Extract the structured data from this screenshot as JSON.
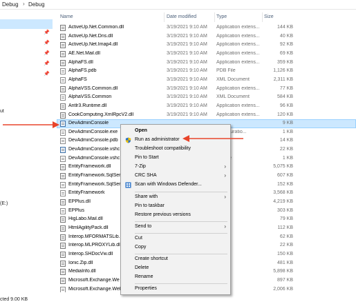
{
  "breadcrumb": {
    "part1": "Debug",
    "sep": "›",
    "part2": "Debug"
  },
  "nav": {
    "fragment_out": "ut",
    "fragment_drive": "(E:)"
  },
  "header": {
    "name": "Name",
    "date": "Date modified",
    "type": "Type",
    "size": "Size"
  },
  "files": [
    {
      "name": "ActiveUp.Net.Common.dll",
      "date": "3/19/2021 9:10 AM",
      "type": "Application extens...",
      "size": "144 KB",
      "kind": "dll"
    },
    {
      "name": "ActiveUp.Net.Dns.dll",
      "date": "3/19/2021 9:10 AM",
      "type": "Application extens...",
      "size": "40 KB",
      "kind": "dll"
    },
    {
      "name": "ActiveUp.Net.Imap4.dll",
      "date": "3/19/2021 9:10 AM",
      "type": "Application extens...",
      "size": "92 KB",
      "kind": "dll"
    },
    {
      "name": "AE.Net.Mail.dll",
      "date": "3/19/2021 9:10 AM",
      "type": "Application extens...",
      "size": "69 KB",
      "kind": "dll"
    },
    {
      "name": "AlphaFS.dll",
      "date": "3/19/2021 9:10 AM",
      "type": "Application extens...",
      "size": "359 KB",
      "kind": "dll"
    },
    {
      "name": "AlphaFS.pdb",
      "date": "3/19/2021 9:10 AM",
      "type": "PDB File",
      "size": "1,126 KB",
      "kind": "file"
    },
    {
      "name": "AlphaFS",
      "date": "3/19/2021 9:10 AM",
      "type": "XML Document",
      "size": "2,311 KB",
      "kind": "file"
    },
    {
      "name": "AlphaVSS.Common.dll",
      "date": "3/19/2021 9:10 AM",
      "type": "Application extens...",
      "size": "77 KB",
      "kind": "dll"
    },
    {
      "name": "AlphaVSS.Common",
      "date": "3/19/2021 9:10 AM",
      "type": "XML Document",
      "size": "584 KB",
      "kind": "file"
    },
    {
      "name": "Antlr3.Runtime.dll",
      "date": "3/19/2021 9:10 AM",
      "type": "Application extens...",
      "size": "96 KB",
      "kind": "dll"
    },
    {
      "name": "CookComputing.XmlRpcV2.dll",
      "date": "3/19/2021 9:10 AM",
      "type": "Application extens...",
      "size": "120 KB",
      "kind": "dll"
    },
    {
      "name": "DevAdminConsole",
      "date": "",
      "type": "",
      "size": "9 KB",
      "kind": "exe",
      "selected": true
    },
    {
      "name": "DevAdminConsole.exe",
      "date": "",
      "type": "Configuratio...",
      "size": "1 KB",
      "kind": "file"
    },
    {
      "name": "DevAdminConsole.pdb",
      "date": "",
      "type": "",
      "size": "14 KB",
      "kind": "file"
    },
    {
      "name": "DevAdminConsole.vshc",
      "date": "",
      "type": "",
      "size": "22 KB",
      "kind": "exe"
    },
    {
      "name": "DevAdminConsole.vshc",
      "date": "",
      "type": "ST File",
      "size": "1 KB",
      "kind": "file"
    },
    {
      "name": "EntityFramework.dll",
      "date": "",
      "type": "",
      "size": "5,075 KB",
      "kind": "dll"
    },
    {
      "name": "EntityFramework.SqlSer",
      "date": "",
      "type": "",
      "size": "607 KB",
      "kind": "dll"
    },
    {
      "name": "EntityFramework.SqlSer",
      "date": "",
      "type": "",
      "size": "152 KB",
      "kind": "file"
    },
    {
      "name": "EntityFramework",
      "date": "",
      "type": "",
      "size": "3,568 KB",
      "kind": "file"
    },
    {
      "name": "EPPlus.dll",
      "date": "",
      "type": "",
      "size": "4,219 KB",
      "kind": "dll"
    },
    {
      "name": "EPPlus",
      "date": "",
      "type": "",
      "size": "303 KB",
      "kind": "file"
    },
    {
      "name": "HigLabo.Mail.dll",
      "date": "",
      "type": "",
      "size": "79 KB",
      "kind": "dll"
    },
    {
      "name": "HtmlAgilityPack.dll",
      "date": "",
      "type": "",
      "size": "112 KB",
      "kind": "dll"
    },
    {
      "name": "Interop.MFORMATSLib.",
      "date": "",
      "type": "",
      "size": "62 KB",
      "kind": "dll"
    },
    {
      "name": "Interop.MLPROXYLib.dll",
      "date": "",
      "type": "",
      "size": "22 KB",
      "kind": "dll"
    },
    {
      "name": "Interop.SHDocVw.dll",
      "date": "",
      "type": "",
      "size": "150 KB",
      "kind": "dll"
    },
    {
      "name": "Ionic.Zip.dll",
      "date": "",
      "type": "",
      "size": "481 KB",
      "kind": "dll"
    },
    {
      "name": "MediaInfo.dll",
      "date": "",
      "type": "",
      "size": "5,898 KB",
      "kind": "dll"
    },
    {
      "name": "Microsoft.Exchange.We",
      "date": "",
      "type": "",
      "size": "897 KB",
      "kind": "dll"
    },
    {
      "name": "Microsoft.Exchange.Web",
      "date": "",
      "type": "",
      "size": "2,006 KB",
      "kind": "file"
    }
  ],
  "status": {
    "text": "cted  9.00 KB"
  },
  "menu": {
    "open": "Open",
    "run_as_admin": "Run as administrator",
    "troubleshoot": "Troubleshoot compatibility",
    "pin_start": "Pin to Start",
    "seven_zip": "7-Zip",
    "crc_sha": "CRC SHA",
    "defender": "Scan with Windows Defender...",
    "share_with": "Share with",
    "pin_taskbar": "Pin to taskbar",
    "restore_versions": "Restore previous versions",
    "send_to": "Send to",
    "cut": "Cut",
    "copy": "Copy",
    "create_shortcut": "Create shortcut",
    "delete": "Delete",
    "rename": "Rename",
    "properties": "Properties",
    "submenu_arrow": "›"
  },
  "colors": {
    "selection": "#cce8ff",
    "annotation_red": "#e8442a",
    "menu_bg": "#f2f2f2",
    "shield_blue": "#2a72c8",
    "shield_yellow": "#f5c400"
  },
  "icons": {
    "row_exe": "application-icon",
    "row_file": "file-icon",
    "pin": "pin-icon",
    "shield": "uac-shield-icon",
    "defender": "defender-icon"
  }
}
